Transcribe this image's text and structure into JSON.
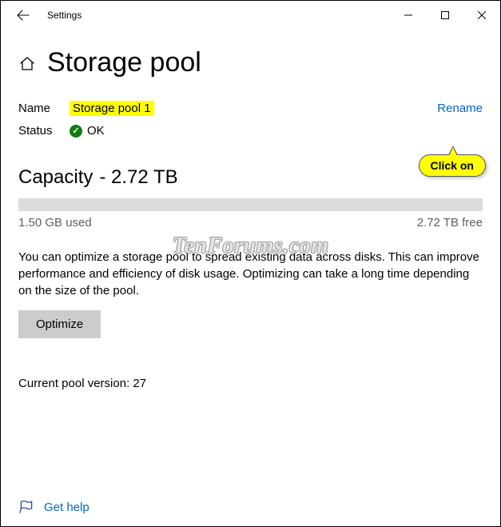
{
  "titlebar": {
    "title": "Settings"
  },
  "page": {
    "title": "Storage pool"
  },
  "info": {
    "name_label": "Name",
    "name_value": "Storage pool 1",
    "status_label": "Status",
    "status_value": "OK",
    "rename": "Rename"
  },
  "capacity": {
    "heading_prefix": "Capacity",
    "heading_value": "- 2.72 TB",
    "used": "1.50 GB used",
    "free": "2.72 TB free"
  },
  "optimize": {
    "description": "You can optimize a storage pool to spread existing data across disks. This can improve performance and efficiency of disk usage. Optimizing can take a long time depending on the size of the pool.",
    "button": "Optimize"
  },
  "pool_version": "Current pool version: 27",
  "footer": {
    "get_help": "Get help"
  },
  "callout": {
    "text": "Click on"
  },
  "watermark": "TenForums.com"
}
